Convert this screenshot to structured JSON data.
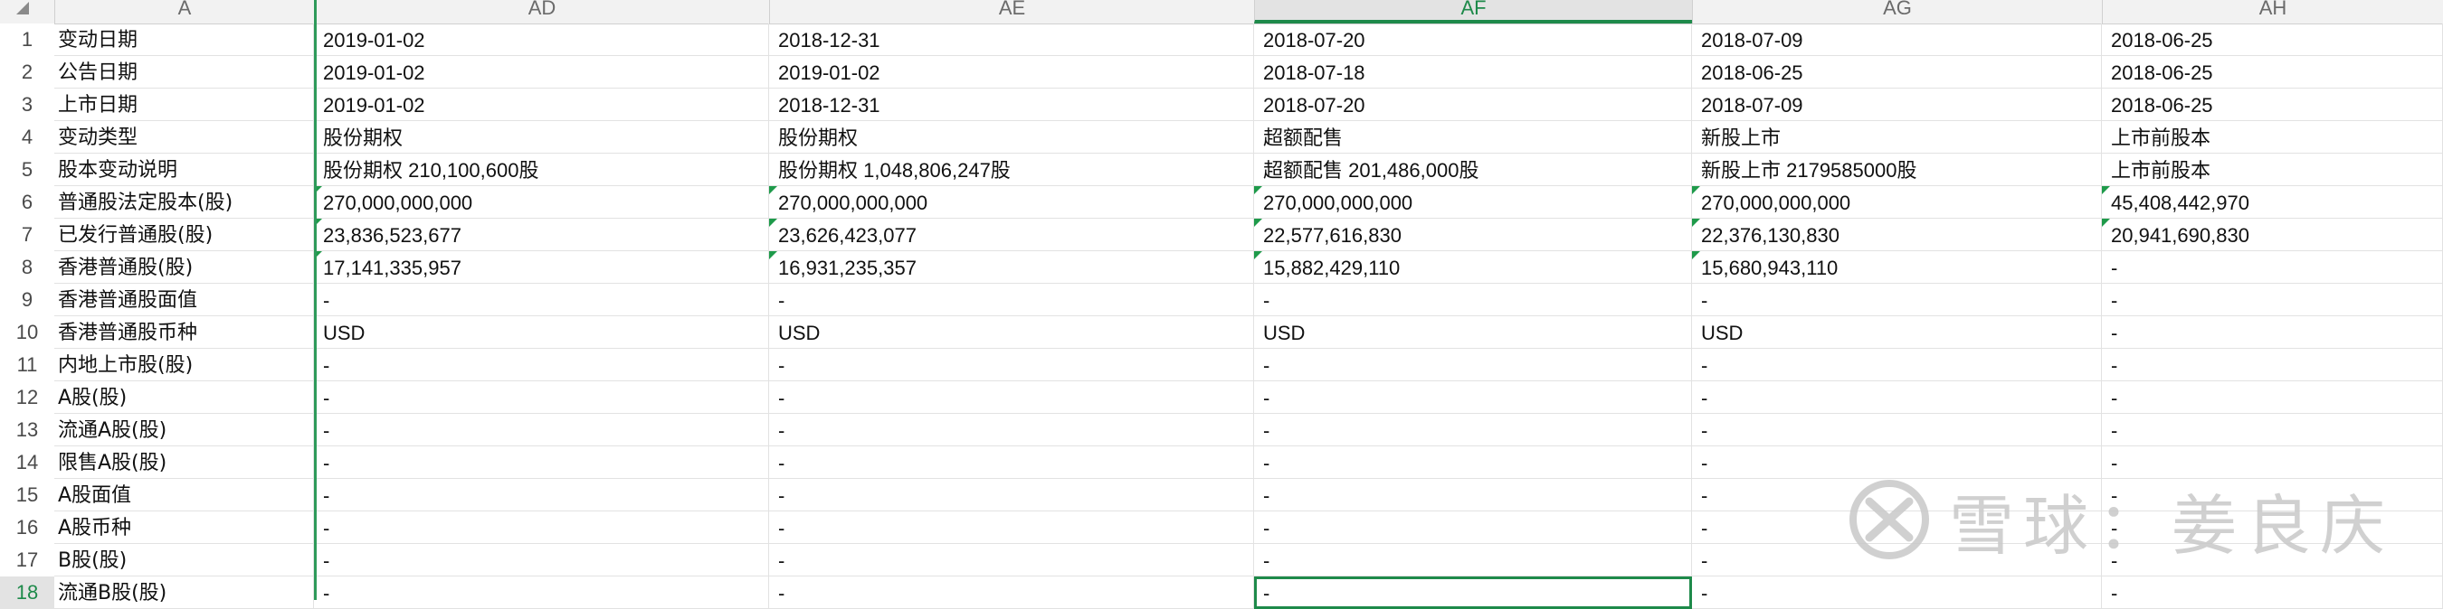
{
  "app": {
    "name": "Spreadsheet"
  },
  "columns": [
    {
      "key": "A",
      "label": "A"
    },
    {
      "key": "AD",
      "label": "AD"
    },
    {
      "key": "AE",
      "label": "AE"
    },
    {
      "key": "AF",
      "label": "AF",
      "active": true
    },
    {
      "key": "AG",
      "label": "AG"
    },
    {
      "key": "AH",
      "label": "AH"
    }
  ],
  "rows": [
    {
      "num": "1",
      "cells": [
        "变动日期",
        "2019-01-02",
        "2018-12-31",
        "2018-07-20",
        "2018-07-09",
        "2018-06-25"
      ]
    },
    {
      "num": "2",
      "cells": [
        "公告日期",
        "2019-01-02",
        "2019-01-02",
        "2018-07-18",
        "2018-06-25",
        "2018-06-25"
      ]
    },
    {
      "num": "3",
      "cells": [
        "上市日期",
        "2019-01-02",
        "2018-12-31",
        "2018-07-20",
        "2018-07-09",
        "2018-06-25"
      ]
    },
    {
      "num": "4",
      "cells": [
        "变动类型",
        "股份期权",
        "股份期权",
        "超额配售",
        "新股上市",
        "上市前股本"
      ]
    },
    {
      "num": "5",
      "cells": [
        "股本变动说明",
        "股份期权 210,100,600股",
        "股份期权 1,048,806,247股",
        "超额配售 201,486,000股",
        "新股上市 2179585000股",
        "上市前股本"
      ]
    },
    {
      "num": "6",
      "cells": [
        "普通股法定股本(股)",
        "270,000,000,000",
        "270,000,000,000",
        "270,000,000,000",
        "270,000,000,000",
        "45,408,442,970"
      ]
    },
    {
      "num": "7",
      "cells": [
        "已发行普通股(股)",
        "23,836,523,677",
        "23,626,423,077",
        "22,577,616,830",
        "22,376,130,830",
        "20,941,690,830"
      ]
    },
    {
      "num": "8",
      "cells": [
        "香港普通股(股)",
        "17,141,335,957",
        "16,931,235,357",
        "15,882,429,110",
        "15,680,943,110",
        "-"
      ]
    },
    {
      "num": "9",
      "cells": [
        "香港普通股面值",
        "-",
        "-",
        "-",
        "-",
        "-"
      ]
    },
    {
      "num": "10",
      "cells": [
        "香港普通股币种",
        "USD",
        "USD",
        "USD",
        "USD",
        "-"
      ]
    },
    {
      "num": "11",
      "cells": [
        "内地上市股(股)",
        "-",
        "-",
        "-",
        "-",
        "-"
      ]
    },
    {
      "num": "12",
      "cells": [
        "A股(股)",
        "-",
        "-",
        "-",
        "-",
        "-"
      ]
    },
    {
      "num": "13",
      "cells": [
        "流通A股(股)",
        "-",
        "-",
        "-",
        "-",
        "-"
      ]
    },
    {
      "num": "14",
      "cells": [
        "限售A股(股)",
        "-",
        "-",
        "-",
        "-",
        "-"
      ]
    },
    {
      "num": "15",
      "cells": [
        "A股面值",
        "-",
        "-",
        "-",
        "-",
        "-"
      ]
    },
    {
      "num": "16",
      "cells": [
        "A股币种",
        "-",
        "-",
        "-",
        "-",
        "-"
      ]
    },
    {
      "num": "17",
      "cells": [
        "B股(股)",
        "-",
        "-",
        "-",
        "-",
        "-"
      ]
    },
    {
      "num": "18",
      "cells": [
        "流通B股(股)",
        "-",
        "-",
        "-",
        "-",
        "-"
      ],
      "active": true
    }
  ],
  "numeric_flag_rows": [
    6,
    7,
    8
  ],
  "selected_cell": {
    "row": 18,
    "col": "AF"
  },
  "watermark": {
    "text": "雪球：姜良庆",
    "icon": "xueqiu-logo-icon"
  },
  "colors": {
    "accent": "#1e8a4a",
    "flag": "#1e9a4a"
  }
}
